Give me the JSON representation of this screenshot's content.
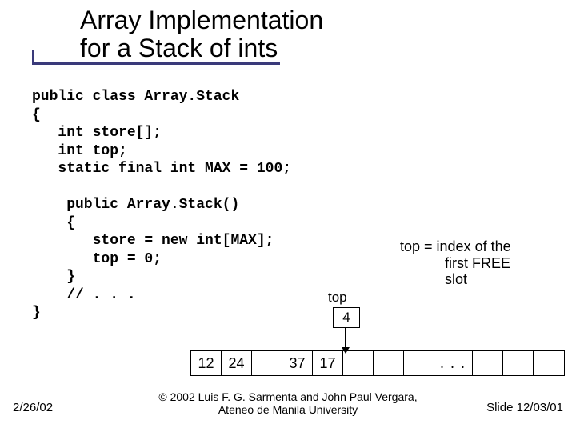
{
  "title": {
    "line1": "Array Implementation",
    "line2": "for a Stack of ints"
  },
  "code": "public class Array.Stack\n{\n   int store[];\n   int top;\n   static final int MAX = 100;\n\n    public Array.Stack()\n    {\n       store = new int[MAX];\n       top = 0;\n    }\n    // . . .\n}",
  "note": {
    "l1": "top = index of the",
    "l2": "first FREE",
    "l3": "slot"
  },
  "top": {
    "label": "top",
    "value": "4"
  },
  "array": {
    "cells": [
      "12",
      "24",
      "",
      "37",
      "17",
      "",
      "",
      "",
      ". . .",
      "",
      "",
      ""
    ]
  },
  "footer": {
    "date": "2/26/02",
    "copyright_l1": "© 2002 Luis F. G. Sarmenta and John Paul Vergara,",
    "copyright_l2": "Ateneo de Manila University",
    "slide": "Slide 12/03/01"
  }
}
